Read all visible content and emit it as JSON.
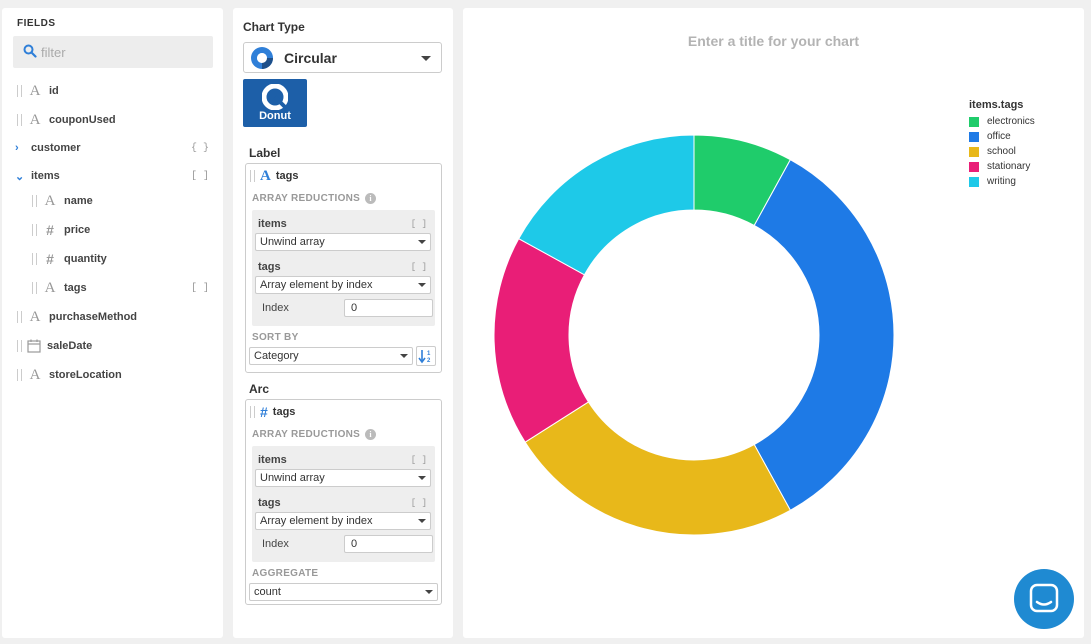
{
  "fields": {
    "header": "FIELDS",
    "filter_placeholder": "filter",
    "items": [
      {
        "label": "id"
      },
      {
        "label": "couponUsed"
      },
      {
        "label": "customer",
        "trail": "{ }"
      },
      {
        "label": "items",
        "trail": "[ ]"
      },
      {
        "label": "name"
      },
      {
        "label": "price"
      },
      {
        "label": "quantity"
      },
      {
        "label": "tags",
        "trail": "[ ]"
      },
      {
        "label": "purchaseMethod"
      },
      {
        "label": "saleDate"
      },
      {
        "label": "storeLocation"
      }
    ]
  },
  "encoding": {
    "chart_type_title": "Chart Type",
    "chart_type_value": "Circular",
    "subtype_label": "Donut",
    "label_section": {
      "title": "Label",
      "field": "tags",
      "array_reductions_title": "ARRAY REDUCTIONS",
      "red1_label": "items",
      "red1_value": "Unwind array",
      "red2_label": "tags",
      "red2_value": "Array element by index",
      "index_label": "Index",
      "index_value": "0",
      "sort_title": "SORT BY",
      "sort_value": "Category"
    },
    "arc_section": {
      "title": "Arc",
      "field": "tags",
      "array_reductions_title": "ARRAY REDUCTIONS",
      "red1_label": "items",
      "red1_value": "Unwind array",
      "red2_label": "tags",
      "red2_value": "Array element by index",
      "index_label": "Index",
      "index_value": "0",
      "aggregate_title": "AGGREGATE",
      "aggregate_value": "count"
    }
  },
  "chart": {
    "title_placeholder": "Enter a title for your chart",
    "legend_title": "items.tags"
  },
  "chart_data": {
    "type": "pie",
    "variant": "donut",
    "categories": [
      "electronics",
      "office",
      "school",
      "stationary",
      "writing"
    ],
    "values": [
      8,
      34,
      24,
      17,
      17
    ],
    "colors": [
      "#1fcc6b",
      "#1e7ae6",
      "#e8b81a",
      "#e91e77",
      "#1ec9e8"
    ]
  }
}
